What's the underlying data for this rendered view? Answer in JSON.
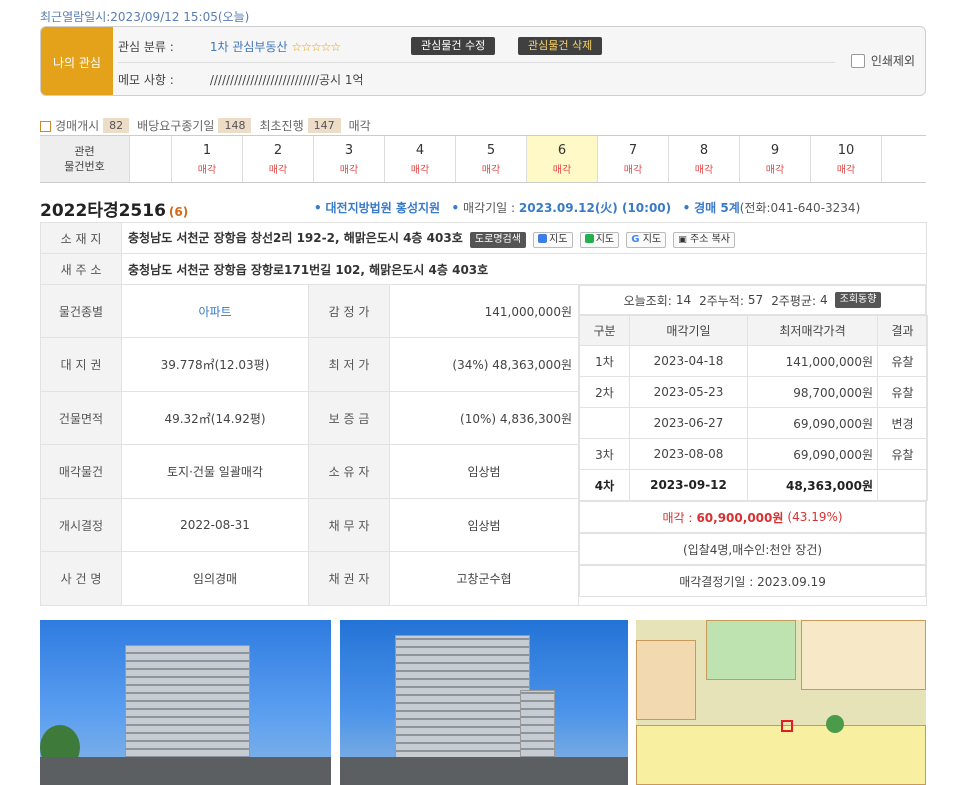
{
  "recent_view": "최근열람일시:2023/09/12 15:05(오늘)",
  "favorite": {
    "label": "나의 관심",
    "category_key": "관심 분류 :",
    "category_value": "1차 관심부동산",
    "stars": "☆☆☆☆☆",
    "edit_button": "관심물건 수정",
    "delete_button": "관심물건 삭제",
    "memo_key": "메모 사항 :",
    "memo_value": "///////////////////////////공시 1억",
    "print_exclude": "인쇄제외"
  },
  "steps": {
    "start_label": "경매개시",
    "start_num": "82",
    "demand_label": "배당요구종기일",
    "demand_num": "148",
    "first_label": "최초진행",
    "first_num": "147",
    "sold_label": "매각"
  },
  "related": {
    "header": "관련\n물건번호",
    "items": [
      {
        "num": "1",
        "status": "매각"
      },
      {
        "num": "2",
        "status": "매각"
      },
      {
        "num": "3",
        "status": "매각"
      },
      {
        "num": "4",
        "status": "매각"
      },
      {
        "num": "5",
        "status": "매각"
      },
      {
        "num": "6",
        "status": "매각"
      },
      {
        "num": "7",
        "status": "매각"
      },
      {
        "num": "8",
        "status": "매각"
      },
      {
        "num": "9",
        "status": "매각"
      },
      {
        "num": "10",
        "status": "매각"
      }
    ],
    "active_index": 5
  },
  "case": {
    "number": "2022타경2516",
    "count": "(6)",
    "court": "대전지방법원 홍성지원",
    "sale_date_label": "매각기일 :",
    "sale_date": "2023.09.12(火) (10:00)",
    "dept": "경매 5계",
    "phone": "(전화:041-640-3234)"
  },
  "address": {
    "label": "소 재 지",
    "value": "충청남도 서천군 장항읍 창선2리 192-2, 해맑은도시 4층 403호",
    "btn_road": "도로명검색",
    "btn_daum": "지도",
    "btn_naver": "지도",
    "btn_google": "지도",
    "btn_copy": "주소 복사",
    "new_label": "새 주 소",
    "new_value": "충청남도 서천군 장항읍 장항로171번길 102, 해맑은도시 4층 403호"
  },
  "details": [
    {
      "label": "물건종별",
      "value": "아파트",
      "label2": "감 정 가",
      "value2": "141,000,000원"
    },
    {
      "label": "대 지 권",
      "value": "39.778㎡(12.03평)",
      "label2": "최 저 가",
      "value2": "(34%) 48,363,000원"
    },
    {
      "label": "건물면적",
      "value": "49.32㎡(14.92평)",
      "label2": "보 증 금",
      "value2": "(10%) 4,836,300원"
    },
    {
      "label": "매각물건",
      "value": "토지·건물 일괄매각",
      "label2": "소 유 자",
      "value2": "임상범"
    },
    {
      "label": "개시결정",
      "value": "2022-08-31",
      "label2": "채 무 자",
      "value2": "임상범"
    },
    {
      "label": "사 건 명",
      "value": "임의경매",
      "label2": "채 권 자",
      "value2": "고창군수협"
    }
  ],
  "views": {
    "today_label": "오늘조회:",
    "today": "14",
    "two_week_label": "2주누적:",
    "two_week": "57",
    "avg_label": "2주평균:",
    "avg": "4",
    "trend_button": "조회동향"
  },
  "history": {
    "headers": [
      "구분",
      "매각기일",
      "최저매각가격",
      "결과"
    ],
    "rows": [
      {
        "round": "1차",
        "date": "2023-04-18",
        "price": "141,000,000원",
        "result": "유찰"
      },
      {
        "round": "2차",
        "date": "2023-05-23",
        "price": "98,700,000원",
        "result": "유찰"
      },
      {
        "round": "",
        "date": "2023-06-27",
        "price": "69,090,000원",
        "result": "변경"
      },
      {
        "round": "3차",
        "date": "2023-08-08",
        "price": "69,090,000원",
        "result": "유찰"
      },
      {
        "round": "4차",
        "date": "2023-09-12",
        "price": "48,363,000원",
        "result": ""
      }
    ]
  },
  "sale": {
    "label": "매각 :",
    "price": "60,900,000원",
    "ratio": "(43.19%)",
    "bidders": "(입찰4명,매수인:천안 장건)",
    "decision": "매각결정기일 : 2023.09.19"
  },
  "colors": {
    "favorite_bg": "#e3a21a",
    "accent_blue": "#3a7bc8",
    "status_red": "#e04848",
    "active_cell": "#fff8c7"
  }
}
